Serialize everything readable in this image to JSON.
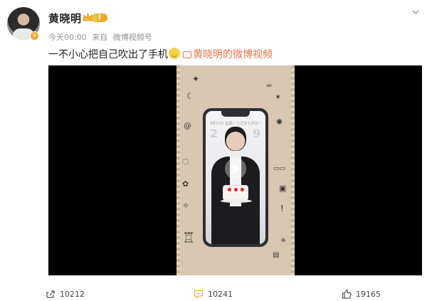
{
  "post": {
    "author": {
      "name": "黄晓明",
      "verified_badge": "v",
      "vip_level": "I",
      "avatar_icon": "user-avatar"
    },
    "meta": {
      "time": "今天00:00",
      "source_prefix": "来自",
      "source": "微博视频号"
    },
    "content": {
      "text": "一不小心把自己吹出了手机",
      "link_text": "黄晓明的微博视频"
    },
    "video": {
      "phone_screen_status": "9月12日 星期二   乙巳年七月廿一",
      "phone_screen_digits_left": "2",
      "phone_screen_digits_right": "9"
    },
    "actions": {
      "repost_count": "10212",
      "comment_count": "10241",
      "like_count": "19165"
    }
  },
  "colors": {
    "accent_orange": "#eb7350",
    "vip_gold": "#f0a020",
    "comment_icon": "#f0b830"
  }
}
